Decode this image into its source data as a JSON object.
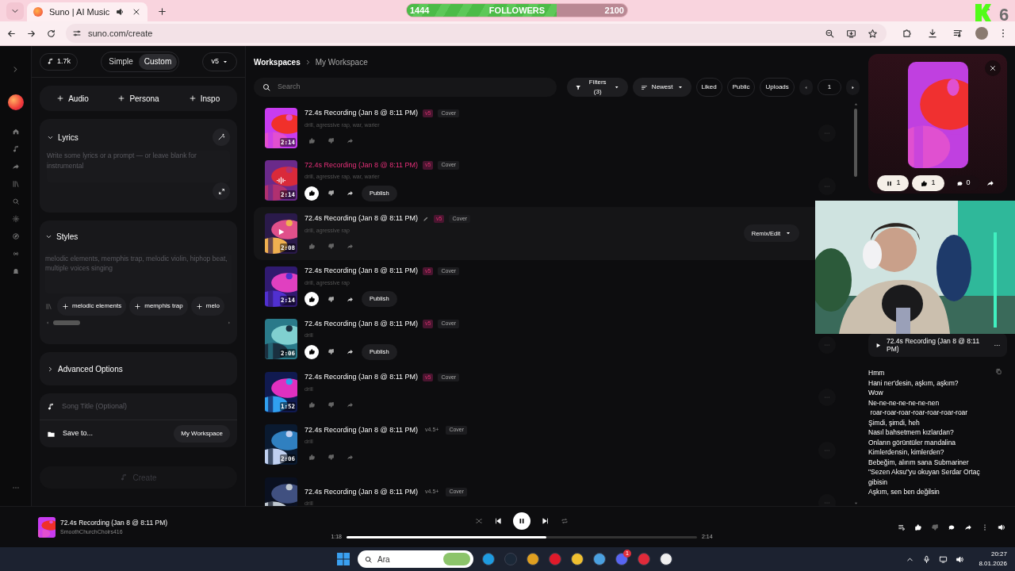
{
  "browser": {
    "tab_title": "Suno | AI Music",
    "url": "suno.com/create"
  },
  "stream_overlay": {
    "current": "1444",
    "label": "FOLLOWERS",
    "goal": "2100",
    "level": 0.68,
    "corner_text": "6"
  },
  "create_panel": {
    "credits": "1.7k",
    "modes": [
      {
        "label": "Simple",
        "selected": false
      },
      {
        "label": "Custom",
        "selected": true
      }
    ],
    "model": "v5",
    "add_buttons": [
      "Audio",
      "Persona",
      "Inspo"
    ],
    "lyrics": {
      "title": "Lyrics",
      "expanded": true,
      "placeholder": "Write some lyrics or a prompt — or leave blank for instrumental"
    },
    "styles": {
      "title": "Styles",
      "expanded": true,
      "placeholder": "melodic elements, memphis trap, melodic violin, hiphop beat, multiple voices singing",
      "chips": [
        "melodic elements",
        "memphis trap",
        "melo"
      ]
    },
    "advanced": {
      "title": "Advanced Options",
      "expanded": false
    },
    "song_title_placeholder": "Song Title (Optional)",
    "save_to": "Save to...",
    "workspace": "My Workspace",
    "create_button": {
      "label": "Create",
      "disabled": true
    }
  },
  "breadcrumb": [
    "Workspaces",
    "My Workspace"
  ],
  "toolbar": {
    "search_placeholder": "Search",
    "filters": "Filters (3)",
    "sort": "Newest",
    "toggles": [
      "Liked",
      "Public",
      "Uploads"
    ],
    "page": "1"
  },
  "songs": [
    {
      "title": "72.4s Recording (Jan 8 @ 8:11 PM)",
      "version": {
        "label": "v5",
        "accent": true
      },
      "tag": "Cover",
      "tags": "drill, agressive rap, war, warier",
      "duration": "2:14",
      "playing": false,
      "highlighted": false,
      "liked": false,
      "more_button": true
    },
    {
      "title": "72.4s Recording (Jan 8 @ 8:11 PM)",
      "version": {
        "label": "v5",
        "accent": true
      },
      "tag": "Cover",
      "tags": "drill, agressive rap, war, warier",
      "duration": "2:14",
      "playing": true,
      "highlighted": false,
      "liked": true,
      "publish": "Publish",
      "more_button": true
    },
    {
      "title": "72.4s Recording (Jan 8 @ 8:11 PM)",
      "version": {
        "label": "v5",
        "accent": true
      },
      "tag": "Cover",
      "tags": "drill, agressive rap",
      "duration": "2:08",
      "playing": false,
      "highlighted": true,
      "liked": false,
      "action_button": "Remix/Edit",
      "more_button": false
    },
    {
      "title": "72.4s Recording (Jan 8 @ 8:11 PM)",
      "version": {
        "label": "v5",
        "accent": true
      },
      "tag": "Cover",
      "tags": "drill, agressive rap",
      "duration": "2:14",
      "playing": false,
      "highlighted": false,
      "liked": true,
      "publish": "Publish",
      "more_button": false
    },
    {
      "title": "72.4s Recording (Jan 8 @ 8:11 PM)",
      "version": {
        "label": "v5",
        "accent": true
      },
      "tag": "Cover",
      "tags": "drill",
      "duration": "2:06",
      "playing": false,
      "highlighted": false,
      "liked": true,
      "publish": "Publish",
      "more_button": true
    },
    {
      "title": "72.4s Recording (Jan 8 @ 8:11 PM)",
      "version": {
        "label": "v5",
        "accent": true
      },
      "tag": "Cover",
      "tags": "drill",
      "duration": "1:52",
      "playing": false,
      "highlighted": false,
      "liked": false,
      "more_button": true
    },
    {
      "title": "72.4s Recording (Jan 8 @ 8:11 PM)",
      "version": {
        "label": "v4.5+",
        "accent": false
      },
      "tag": "Cover",
      "tags": "drill",
      "duration": "2:06",
      "playing": false,
      "highlighted": false,
      "liked": false,
      "more_button": true
    },
    {
      "title": "72.4s Recording (Jan 8 @ 8:11 PM)",
      "version": {
        "label": "v4.5+",
        "accent": false
      },
      "tag": "Cover",
      "tags": "drill",
      "playing": false,
      "highlighted": false,
      "actions": false,
      "more_button": true
    }
  ],
  "detail": {
    "stats": [
      {
        "kind": "plays",
        "label": "1"
      },
      {
        "kind": "likes",
        "label": "1"
      },
      {
        "kind": "comments",
        "label": "0"
      }
    ],
    "song_title": "72.4s Recording (Jan 8 @ 8:11 PM)",
    "lyrics": [
      "Hmm",
      "Hani ner'desin, aşkım, aşkım?",
      "Wow",
      "Ne-ne-ne-ne-ne-ne-nen",
      " roar-roar-roar-roar-roar-roar-roar",
      "Şimdi, şimdi, heh",
      "Nasıl bahsetmem kızlardan?",
      "Onların görüntüler mandalina",
      "Kimlerdensin, kimlerden?",
      "Bebeğim, alırım sana Submariner",
      "\"Sezen Aksu\"yu okuyan Serdar Ortaç gibisin",
      "Aşkım, sen ben değilsin"
    ]
  },
  "player": {
    "title": "72.4s Recording (Jan 8 @ 8:11 PM)",
    "artist": "SmoothChurchChoirs416",
    "elapsed": "1:18",
    "total": "2:14",
    "level": 0.57,
    "playing": true
  },
  "taskbar": {
    "search": "Ara",
    "badge": "1",
    "time": "20:27",
    "date": "8.01.2026"
  }
}
